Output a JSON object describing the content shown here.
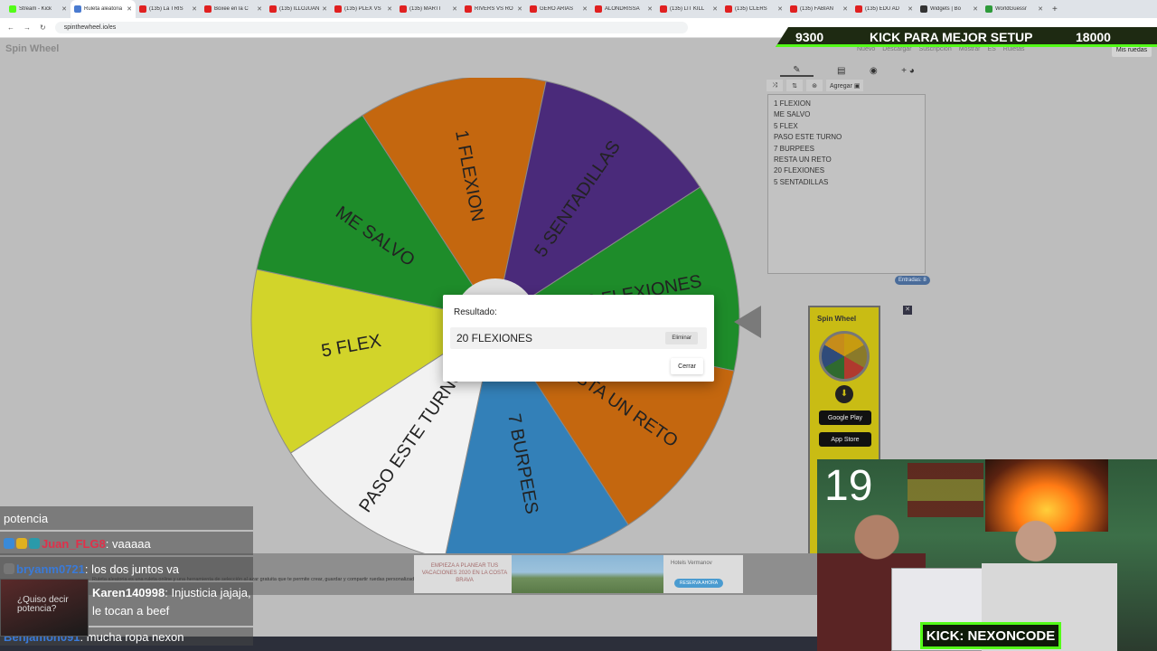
{
  "browser": {
    "tabs": [
      {
        "label": "Stream - Kick",
        "color": "#53fc18",
        "active": false
      },
      {
        "label": "Ruleta aleatoria",
        "color": "#4a7bd0",
        "active": true
      },
      {
        "label": "(135) La TRIS",
        "color": "#e02020",
        "active": false
      },
      {
        "label": "Boxee en la C",
        "color": "#e02020",
        "active": false
      },
      {
        "label": "(135) ILLOJUAN",
        "color": "#e02020",
        "active": false
      },
      {
        "label": "(135) PLEX VS",
        "color": "#e02020",
        "active": false
      },
      {
        "label": "(135) MARTI",
        "color": "#e02020",
        "active": false
      },
      {
        "label": "RIVERS VS RO",
        "color": "#e02020",
        "active": false
      },
      {
        "label": "GERO ARIAS",
        "color": "#e02020",
        "active": false
      },
      {
        "label": "ALONDRISSA",
        "color": "#e02020",
        "active": false
      },
      {
        "label": "(135) LIT KILL",
        "color": "#e02020",
        "active": false
      },
      {
        "label": "(135) CLERS",
        "color": "#e02020",
        "active": false
      },
      {
        "label": "(135) FABIAN",
        "color": "#e02020",
        "active": false
      },
      {
        "label": "(135) EDU AD",
        "color": "#e02020",
        "active": false
      },
      {
        "label": "Widgets | Bo",
        "color": "#333333",
        "active": false
      },
      {
        "label": "WorldGuessr",
        "color": "#2e9a3a",
        "active": false
      }
    ],
    "url": "spinthewheel.io/es"
  },
  "site": {
    "logo": "Spin Wheel",
    "nav": [
      "Nuevo",
      "Descargar",
      "Suscripción",
      "Mostrar",
      "ES",
      "Ruletas",
      "Mis ruedas"
    ],
    "panel_tabs": [
      "✎",
      "▤",
      "◉",
      "+ ◕"
    ],
    "tools": [
      "⤨",
      "⇅",
      "⊛",
      "Agregar ▣"
    ],
    "entries": [
      "1 FLEXION",
      "ME SALVO",
      "5 FLEX",
      "PASO ESTE TURNO",
      "7 BURPEES",
      "RESTA UN RETO",
      "20 FLEXIONES",
      "5 SENTADILLAS"
    ],
    "entry_count": "Entradas: 8",
    "footer_text": "Ruleta aleatoria es una ruleta online y una herramienta de selección al azar gratuita que te permite crear, guardar y compartir ruedas personalizadas con sonidos, y deja que la ruleta elija. Usa la versión en español con todas las mismas funciones.",
    "ad": {
      "logo": "Spin Wheel",
      "google": "Google Play",
      "apple": "App Store"
    },
    "banner": {
      "text": "EMPIEZA A PLANEAR TUS VACACIONES 2020 EN LA COSTA BRAVA",
      "brand": "Hotels Vermanov",
      "cta": "RESERVA AHORA"
    }
  },
  "wheel": {
    "start_angle": -33,
    "segments": [
      {
        "label": "20 FLEXIONES",
        "color": "#1e8c2a"
      },
      {
        "label": "RESTA UN RETO",
        "color": "#c4670f"
      },
      {
        "label": "7 BURPEES",
        "color": "#3380b8"
      },
      {
        "label": "PASO ESTE TURNO",
        "color": "#f2f2f2"
      },
      {
        "label": "5 FLEX",
        "color": "#d2d42a"
      },
      {
        "label": "ME SALVO",
        "color": "#1e8c2a"
      },
      {
        "label": "1 FLEXION",
        "color": "#c4670f"
      },
      {
        "label": "5 SENTADILLAS",
        "color": "#4a2a7a"
      }
    ]
  },
  "modal": {
    "title": "Resultado:",
    "result": "20 FLEXIONES",
    "remove": "Eliminar",
    "close": "Cerrar"
  },
  "overlay": {
    "left_value": "9300",
    "banner_text": "KICK PARA MEJOR SETUP",
    "right_value": "18000",
    "counter": "19",
    "kick_tag": "KICK: NEXONCODE"
  },
  "chat": [
    {
      "user": "",
      "text": "potencia",
      "user_color": "#ffffff"
    },
    {
      "user": "Juan_FLG8",
      "text": ": vaaaaa",
      "user_color": "#e0304a"
    },
    {
      "user": "bryanm0721",
      "text": ": los dos juntos va",
      "user_color": "#3a7ad8"
    },
    {
      "user": "Karen140998",
      "text": ": Injusticia jajaja, le tocan a beef",
      "user_color": "#ffffff"
    },
    {
      "user": "Benjamon091",
      "text": ": mucha ropa nexon",
      "user_color": "#3a7ad8"
    }
  ],
  "chat_image_text": "¿Quiso decir potencia?"
}
